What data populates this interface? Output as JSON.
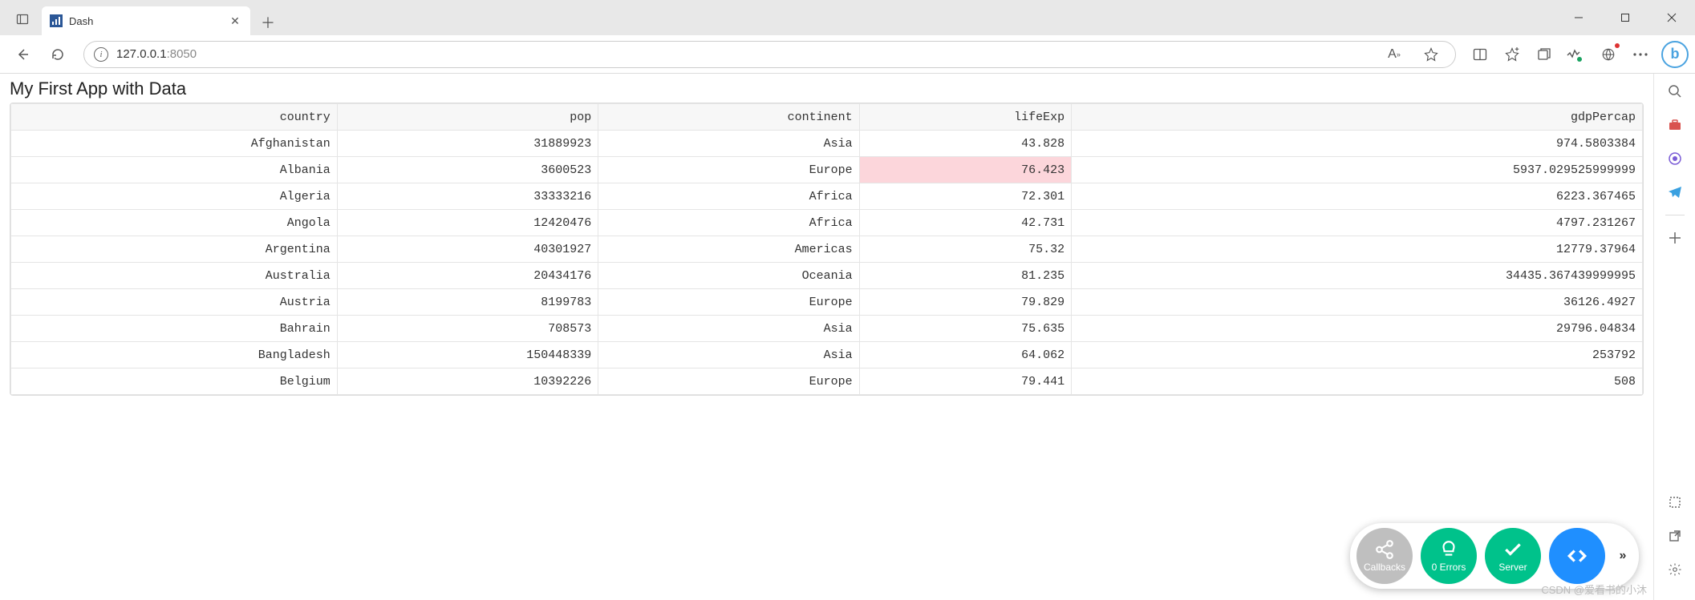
{
  "browser": {
    "tab_title": "Dash",
    "url_host": "127.0.0.1",
    "url_port": ":8050"
  },
  "page": {
    "title": "My First App with Data"
  },
  "table": {
    "columns": [
      "country",
      "pop",
      "continent",
      "lifeExp",
      "gdpPercap"
    ],
    "highlight": {
      "row": 1,
      "col": 3
    },
    "rows": [
      [
        "Afghanistan",
        "31889923",
        "Asia",
        "43.828",
        "974.5803384"
      ],
      [
        "Albania",
        "3600523",
        "Europe",
        "76.423",
        "5937.029525999999"
      ],
      [
        "Algeria",
        "33333216",
        "Africa",
        "72.301",
        "6223.367465"
      ],
      [
        "Angola",
        "12420476",
        "Africa",
        "42.731",
        "4797.231267"
      ],
      [
        "Argentina",
        "40301927",
        "Americas",
        "75.32",
        "12779.37964"
      ],
      [
        "Australia",
        "20434176",
        "Oceania",
        "81.235",
        "34435.367439999995"
      ],
      [
        "Austria",
        "8199783",
        "Europe",
        "79.829",
        "36126.4927"
      ],
      [
        "Bahrain",
        "708573",
        "Asia",
        "75.635",
        "29796.04834"
      ],
      [
        "Bangladesh",
        "150448339",
        "Asia",
        "64.062",
        "253792"
      ],
      [
        "Belgium",
        "10392226",
        "Europe",
        "79.441",
        "508"
      ]
    ]
  },
  "debug": {
    "callbacks": "Callbacks",
    "errors": "0 Errors",
    "server": "Server"
  },
  "watermark": "CSDN @爱看书的小沐"
}
